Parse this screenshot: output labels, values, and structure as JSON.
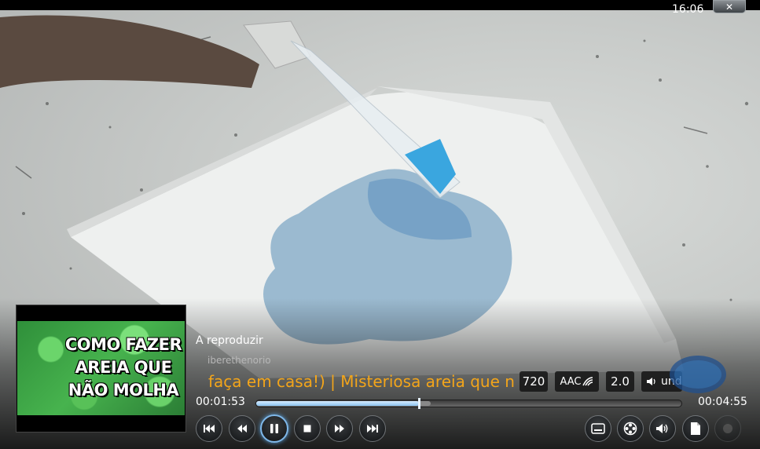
{
  "clock": "16:06",
  "close_label": "✕",
  "thumbnail": {
    "title_lines": [
      "COMO FAZER",
      "AREIA QUE",
      "NÃO MOLHA"
    ]
  },
  "now_playing": {
    "status": "A reproduzir",
    "channel": "iberethenorio",
    "title": "faça em casa!) | Misteriosa areia que n"
  },
  "badges": {
    "resolution": "720",
    "codec": "AAC",
    "channels": "2.0",
    "language": "und"
  },
  "progress": {
    "current": "00:01:53",
    "total": "00:04:55",
    "played_fraction": 0.383,
    "cached_fraction": 0.41
  },
  "controls": [
    "previous-button",
    "rewind-button",
    "pause-button",
    "stop-button",
    "fast-forward-button",
    "next-button"
  ],
  "right_controls": [
    "subtitles-button",
    "video-settings-button",
    "audio-settings-button",
    "bookmarks-button",
    "disabled-button"
  ],
  "colors": {
    "accent": "#7fb8ea",
    "title": "#f3a51a",
    "badge_bg": "#141414"
  }
}
